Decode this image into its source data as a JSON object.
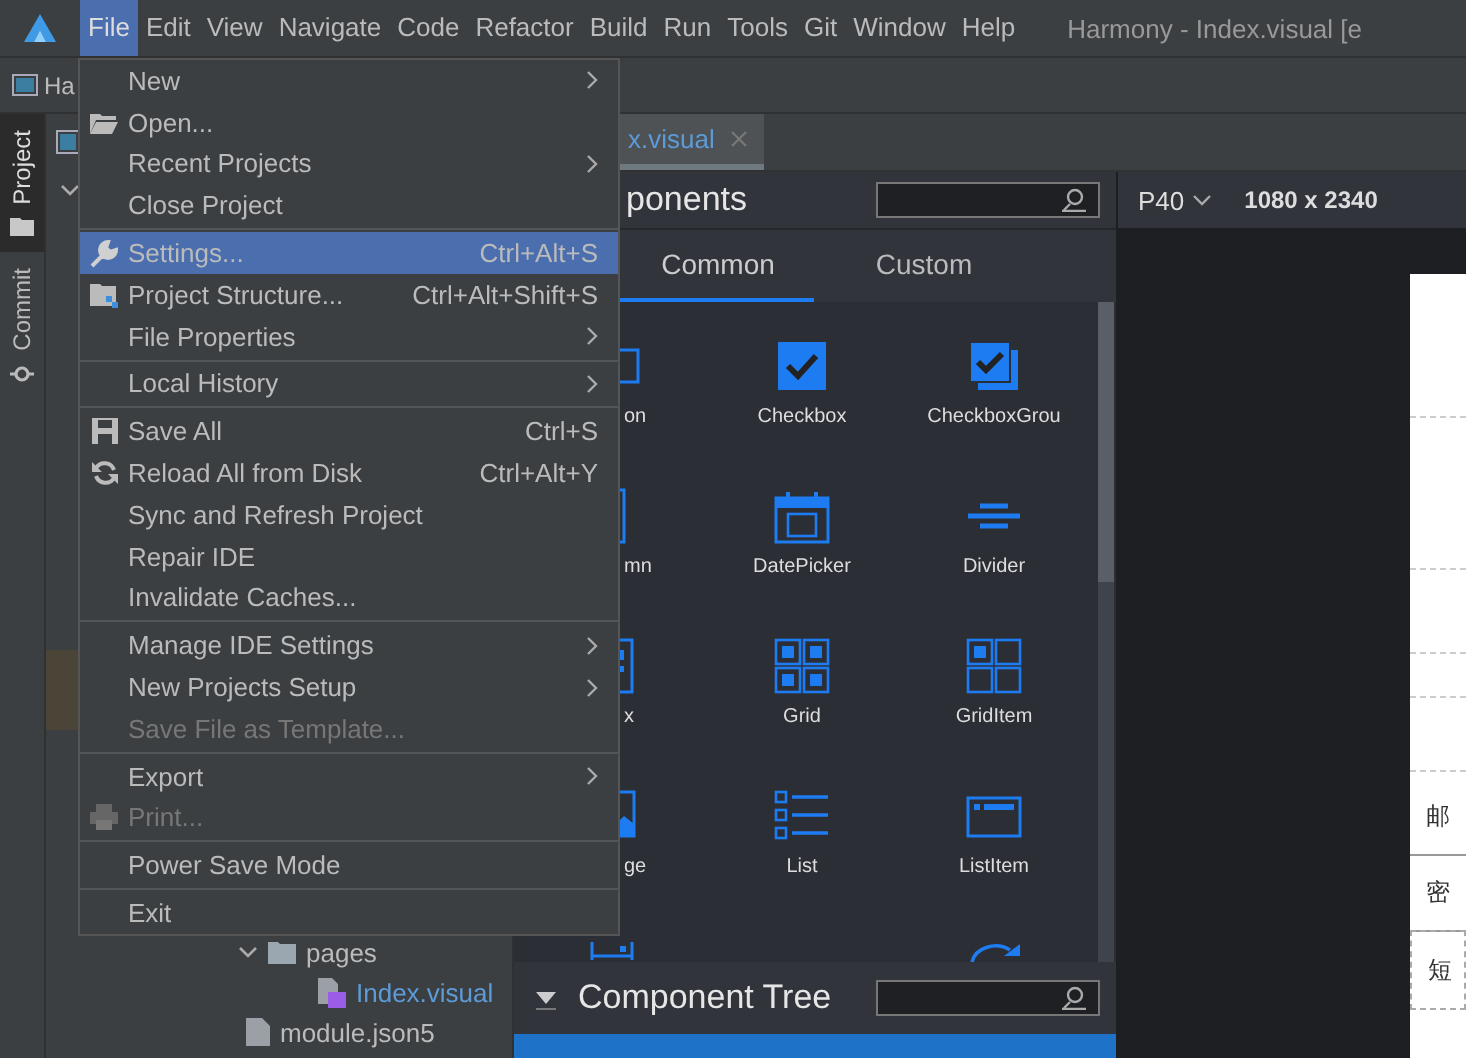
{
  "menubar": {
    "items": [
      {
        "label": "File",
        "selected": true
      },
      {
        "label": "Edit",
        "selected": false
      },
      {
        "label": "View",
        "selected": false
      },
      {
        "label": "Navigate",
        "selected": false
      },
      {
        "label": "Code",
        "selected": false
      },
      {
        "label": "Refactor",
        "selected": false
      },
      {
        "label": "Build",
        "selected": false
      },
      {
        "label": "Run",
        "selected": false
      },
      {
        "label": "Tools",
        "selected": false
      },
      {
        "label": "Git",
        "selected": false
      },
      {
        "label": "Window",
        "selected": false
      },
      {
        "label": "Help",
        "selected": false
      }
    ],
    "title": "Harmony - Index.visual [e"
  },
  "toolbar": {
    "project": "Ha"
  },
  "tool_strip": [
    {
      "label": "Project",
      "selected": true
    },
    {
      "label": "Commit",
      "selected": false
    }
  ],
  "project_tree": [
    {
      "label": "pages",
      "kind": "folder",
      "expanded": true,
      "children": [
        {
          "label": "Index.visual",
          "kind": "visual"
        }
      ]
    },
    {
      "label": "module.json5",
      "kind": "json"
    }
  ],
  "editor_tab": {
    "label": "x.visual"
  },
  "components": {
    "title": "ponents",
    "tabs": [
      {
        "label": "Common",
        "selected": true
      },
      {
        "label": "Custom",
        "selected": false
      }
    ],
    "items": [
      {
        "label": "on",
        "kind": "button"
      },
      {
        "label": "Checkbox",
        "kind": "checkbox"
      },
      {
        "label": "CheckboxGrou",
        "kind": "checkboxgroup"
      },
      {
        "label": "mn",
        "kind": "column"
      },
      {
        "label": "DatePicker",
        "kind": "datepicker"
      },
      {
        "label": "Divider",
        "kind": "divider"
      },
      {
        "label": "x",
        "kind": "flex"
      },
      {
        "label": "Grid",
        "kind": "grid"
      },
      {
        "label": "GridItem",
        "kind": "griditem"
      },
      {
        "label": "ge",
        "kind": "image"
      },
      {
        "label": "List",
        "kind": "list"
      },
      {
        "label": "ListItem",
        "kind": "listitem"
      },
      {
        "kind": "row"
      },
      {
        "kind": "blank"
      },
      {
        "kind": "arc"
      }
    ]
  },
  "component_tree": {
    "title": "Component Tree"
  },
  "device": {
    "name": "P40",
    "resolution": "1080 x 2340"
  },
  "preview": {
    "fields": [
      "邮",
      "密",
      "短"
    ]
  },
  "file_menu": [
    {
      "kind": "item",
      "label": "New",
      "submenu": true,
      "selected": false,
      "disabled": false
    },
    {
      "kind": "open",
      "label": "Open...",
      "selected": false,
      "disabled": false
    },
    {
      "kind": "item",
      "label": "Recent Projects",
      "submenu": true,
      "selected": false,
      "disabled": false
    },
    {
      "kind": "item",
      "label": "Close Project",
      "selected": false,
      "disabled": false
    },
    {
      "kind": "separator"
    },
    {
      "kind": "settings",
      "label": "Settings...",
      "shortcut": "Ctrl+Alt+S",
      "selected": true,
      "disabled": false
    },
    {
      "kind": "structure",
      "label": "Project Structure...",
      "shortcut": "Ctrl+Alt+Shift+S",
      "selected": false,
      "disabled": false
    },
    {
      "kind": "item",
      "label": "File Properties",
      "submenu": true,
      "selected": false,
      "disabled": false
    },
    {
      "kind": "separator"
    },
    {
      "kind": "item",
      "label": "Local History",
      "submenu": true,
      "selected": false,
      "disabled": false
    },
    {
      "kind": "separator"
    },
    {
      "kind": "save",
      "label": "Save All",
      "shortcut": "Ctrl+S",
      "selected": false,
      "disabled": false
    },
    {
      "kind": "reload",
      "label": "Reload All from Disk",
      "shortcut": "Ctrl+Alt+Y",
      "selected": false,
      "disabled": false
    },
    {
      "kind": "item",
      "label": "Sync and Refresh Project",
      "selected": false,
      "disabled": false
    },
    {
      "kind": "item",
      "label": "Repair IDE",
      "selected": false,
      "disabled": false
    },
    {
      "kind": "item",
      "label": "Invalidate Caches...",
      "selected": false,
      "disabled": false
    },
    {
      "kind": "separator"
    },
    {
      "kind": "item",
      "label": "Manage IDE Settings",
      "submenu": true,
      "selected": false,
      "disabled": false
    },
    {
      "kind": "item",
      "label": "New Projects Setup",
      "submenu": true,
      "selected": false,
      "disabled": false
    },
    {
      "kind": "item",
      "label": "Save File as Template...",
      "selected": false,
      "disabled": true
    },
    {
      "kind": "separator"
    },
    {
      "kind": "item",
      "label": "Export",
      "submenu": true,
      "selected": false,
      "disabled": false
    },
    {
      "kind": "print",
      "label": "Print...",
      "selected": false,
      "disabled": true
    },
    {
      "kind": "separator"
    },
    {
      "kind": "item",
      "label": "Power Save Mode",
      "selected": false,
      "disabled": false
    },
    {
      "kind": "separator"
    },
    {
      "kind": "item",
      "label": "Exit",
      "selected": false,
      "disabled": false
    }
  ]
}
